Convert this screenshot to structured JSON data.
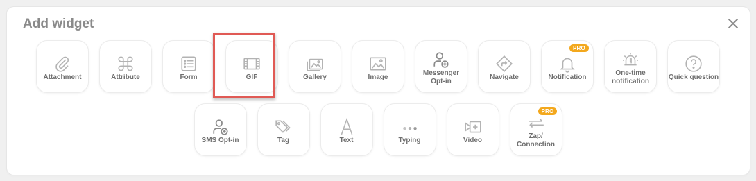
{
  "dialog": {
    "title": "Add widget"
  },
  "row1": [
    {
      "label": "Attachment",
      "icon": "paperclip-icon"
    },
    {
      "label": "Attribute",
      "icon": "command-icon"
    },
    {
      "label": "Form",
      "icon": "form-icon"
    },
    {
      "label": "GIF",
      "icon": "film-icon"
    },
    {
      "label": "Gallery",
      "icon": "gallery-icon"
    },
    {
      "label": "Image",
      "icon": "image-icon"
    },
    {
      "label": "Messenger\nOpt-in",
      "icon": "user-plus-icon"
    },
    {
      "label": "Navigate",
      "icon": "navigate-icon"
    },
    {
      "label": "Notification",
      "icon": "bell-icon",
      "badge": "PRO"
    },
    {
      "label": "One-time\nnotification",
      "icon": "alarm-icon"
    },
    {
      "label": "Quick question",
      "icon": "question-icon"
    }
  ],
  "row2": [
    {
      "label": "SMS Opt-in",
      "icon": "user-plus-icon"
    },
    {
      "label": "Tag",
      "icon": "tag-icon"
    },
    {
      "label": "Text",
      "icon": "text-icon"
    },
    {
      "label": "Typing",
      "icon": "typing-icon"
    },
    {
      "label": "Video",
      "icon": "video-icon"
    },
    {
      "label": "Zap/\nConnection",
      "icon": "zap-icon",
      "badge": "PRO"
    }
  ],
  "highlighted_widget": "GIF",
  "colors": {
    "highlight": "#e05a55",
    "badge": "#f3a81d",
    "text": "#6f6f6f"
  }
}
